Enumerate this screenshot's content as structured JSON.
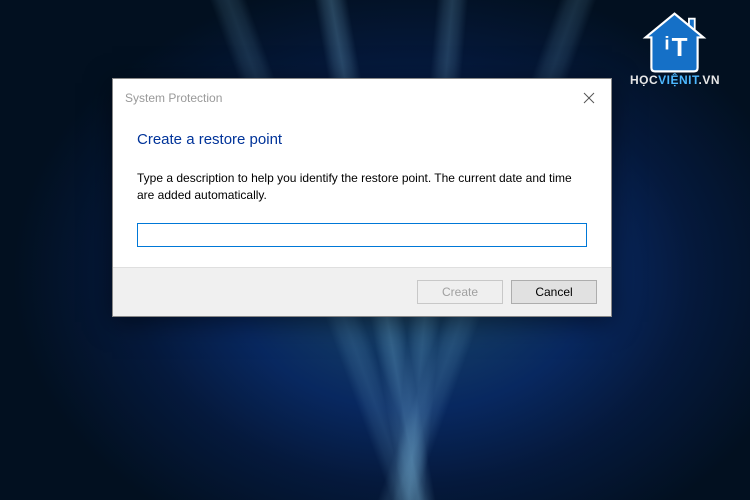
{
  "watermark": {
    "brand_part1": "HỌC",
    "brand_part2": "VIỆNIT",
    "brand_part3": ".VN"
  },
  "dialog": {
    "title": "System Protection",
    "heading": "Create a restore point",
    "description": "Type a description to help you identify the restore point. The current date and time are added automatically.",
    "input_value": "",
    "buttons": {
      "create": "Create",
      "cancel": "Cancel"
    }
  }
}
